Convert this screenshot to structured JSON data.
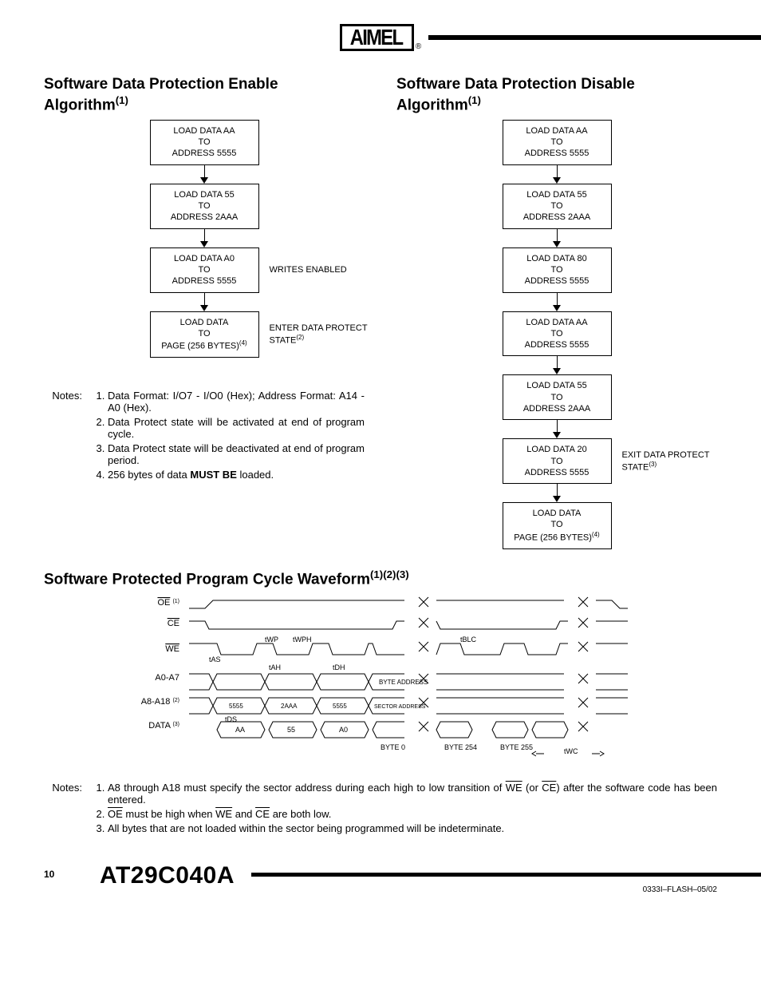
{
  "logo_text": "AIMEL",
  "enable": {
    "title": "Software Data Protection Enable Algorithm",
    "title_sup": "(1)",
    "steps": [
      {
        "l1": "LOAD DATA AA",
        "l2": "TO",
        "l3": "ADDRESS 5555",
        "side": ""
      },
      {
        "l1": "LOAD DATA 55",
        "l2": "TO",
        "l3": "ADDRESS 2AAA",
        "side": ""
      },
      {
        "l1": "LOAD DATA A0",
        "l2": "TO",
        "l3": "ADDRESS 5555",
        "side": "WRITES ENABLED"
      },
      {
        "l1": "LOAD DATA",
        "l2": "TO",
        "l3": "PAGE (256 BYTES)",
        "l3_sup": "(4)",
        "side": "ENTER DATA PROTECT STATE",
        "side_sup": "(2)"
      }
    ]
  },
  "disable": {
    "title": "Software Data Protection Disable Algorithm",
    "title_sup": "(1)",
    "steps": [
      {
        "l1": "LOAD DATA AA",
        "l2": "TO",
        "l3": "ADDRESS 5555"
      },
      {
        "l1": "LOAD DATA 55",
        "l2": "TO",
        "l3": "ADDRESS 2AAA"
      },
      {
        "l1": "LOAD DATA 80",
        "l2": "TO",
        "l3": "ADDRESS 5555"
      },
      {
        "l1": "LOAD DATA AA",
        "l2": "TO",
        "l3": "ADDRESS 5555"
      },
      {
        "l1": "LOAD DATA 55",
        "l2": "TO",
        "l3": "ADDRESS 2AAA"
      },
      {
        "l1": "LOAD DATA 20",
        "l2": "TO",
        "l3": "ADDRESS 5555",
        "side": "EXIT DATA PROTECT STATE",
        "side_sup": "(3)"
      },
      {
        "l1": "LOAD DATA",
        "l2": "TO",
        "l3": "PAGE (256  BYTES)",
        "l3_sup": "(4)"
      }
    ]
  },
  "notes1": {
    "label": "Notes:",
    "items": [
      "Data Format: I/O7 - I/O0 (Hex); Address Format: A14 - A0 (Hex).",
      "Data Protect state will be activated at end of program cycle.",
      "Data Protect state will be deactivated at end of program period.",
      "256 bytes of data <b>MUST BE</b> loaded."
    ]
  },
  "waveform": {
    "title": "Software Protected Program Cycle Waveform",
    "title_sup": "(1)(2)(3)",
    "signals": [
      {
        "label": "OE",
        "overline": true,
        "sup": "(1)"
      },
      {
        "label": "CE",
        "overline": true
      },
      {
        "label": "WE",
        "overline": true
      },
      {
        "label": "A0-A7"
      },
      {
        "label": "A8-A18",
        "sup": "(2)"
      },
      {
        "label": "DATA",
        "sup": "(3)"
      }
    ],
    "timing_labels": [
      "tAS",
      "tWP",
      "tWPH",
      "tAH",
      "tDH",
      "tDS",
      "tBLC",
      "tWC"
    ],
    "bus_values": {
      "a8_a18": [
        "5555",
        "2AAA",
        "5555",
        "SECTOR ADDRESS"
      ],
      "a0_a7": [
        "BYTE ADDRESS"
      ],
      "data": [
        "AA",
        "55",
        "A0"
      ],
      "bytes": [
        "BYTE 0",
        "BYTE 254",
        "BYTE 255"
      ]
    }
  },
  "notes2": {
    "label": "Notes:",
    "items": [
      "A8 through A18 must specify the sector address during each high to low transition of <span class='overline'>WE</span> (or <span class='overline'>CE</span>) after the software code has been entered.",
      "<span class='overline'>OE</span> must be high when <span class='overline'>WE</span> and <span class='overline'>CE</span> are both low.",
      "All bytes that are not loaded within the sector being programmed will be indeterminate."
    ]
  },
  "footer": {
    "page": "10",
    "part": "AT29C040A",
    "docid": "0333I–FLASH–05/02"
  }
}
